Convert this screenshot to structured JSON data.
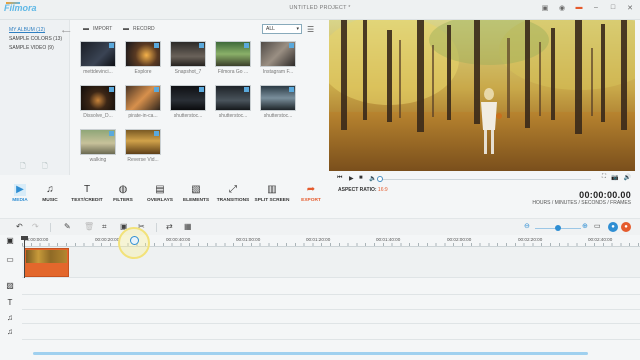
{
  "app": {
    "logo": "Filmora",
    "window_title": "UNTITLED PROJECT *",
    "accent": "#e55b2d",
    "brand": "#2f8ed3"
  },
  "albums": {
    "items": [
      {
        "label": "MY ALBUM (12)",
        "active": true
      },
      {
        "label": "SAMPLE COLORS (13)",
        "active": false
      },
      {
        "label": "SAMPLE VIDEO (9)",
        "active": false
      }
    ]
  },
  "library": {
    "import_label": "IMPORT",
    "record_label": "RECORD",
    "filter_value": "ALL",
    "thumbs": [
      {
        "caption": "mettdevinci..."
      },
      {
        "caption": "Explore"
      },
      {
        "caption": "Snapshot_7"
      },
      {
        "caption": "Filmora Go ..."
      },
      {
        "caption": "Instagram F..."
      },
      {
        "caption": "Dissolve_D..."
      },
      {
        "caption": "pirate-in-ca..."
      },
      {
        "caption": "shutterstoc..."
      },
      {
        "caption": "shutterstoc..."
      },
      {
        "caption": "shutterstoc..."
      },
      {
        "caption": "walking"
      },
      {
        "caption": "Reverse Vid..."
      }
    ]
  },
  "preview": {
    "aspect_label": "ASPECT RATIO:",
    "aspect_value": "16:9",
    "timecode": "00:00:00.00",
    "timecode_units": "HOURS / MINUTES / SECONDS / FRAMES"
  },
  "tabs": [
    {
      "label": "MEDIA",
      "icon": "media-icon"
    },
    {
      "label": "MUSIC",
      "icon": "music-icon"
    },
    {
      "label": "TEXT/CREDIT",
      "icon": "text-icon"
    },
    {
      "label": "FILTERS",
      "icon": "filters-icon"
    },
    {
      "label": "OVERLAYS",
      "icon": "overlays-icon"
    },
    {
      "label": "ELEMENTS",
      "icon": "elements-icon"
    },
    {
      "label": "TRANSITIONS",
      "icon": "transitions-icon"
    },
    {
      "label": "SPLIT SCREEN",
      "icon": "split-screen-icon"
    },
    {
      "label": "EXPORT",
      "icon": "export-icon"
    }
  ],
  "timeline": {
    "ticks": [
      "00:00:00:00",
      "00:00:20:00",
      "00:00:40:00",
      "00:01:00:00",
      "00:01:20:00",
      "00:01:40:00",
      "00:02:00:00",
      "00:02:20:00",
      "00:02:40:00"
    ]
  }
}
